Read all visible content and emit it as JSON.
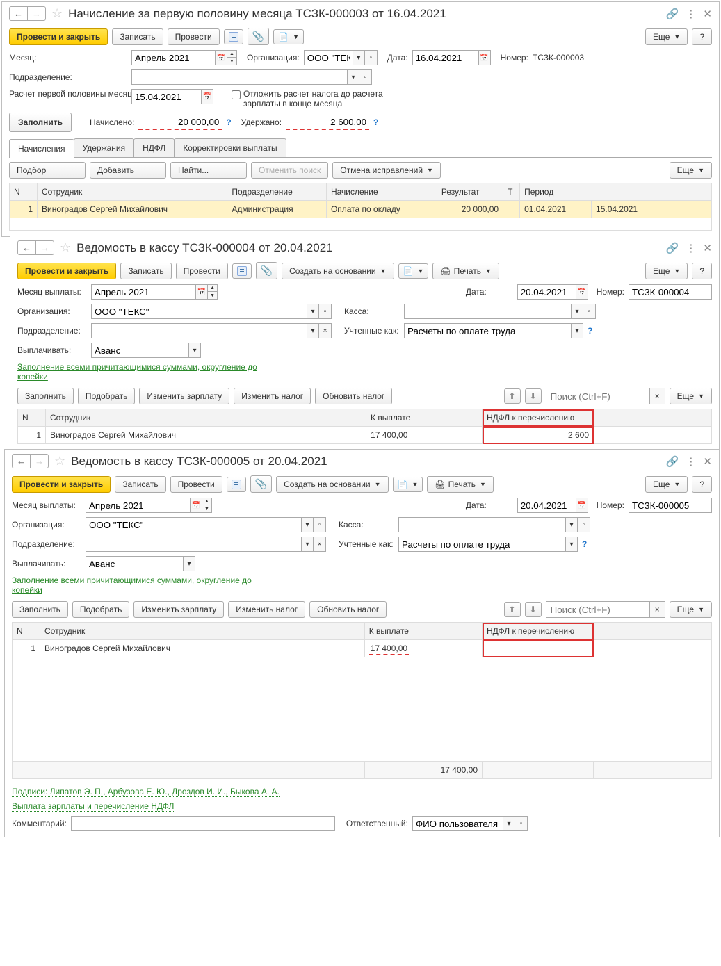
{
  "common": {
    "provesti_zakryt": "Провести и закрыть",
    "zapisat": "Записать",
    "provesti": "Провести",
    "esche": "Еще",
    "help": "?",
    "sozdat_na_osnovanii": "Создать на основании",
    "pechat": "Печать",
    "zapolnit": "Заполнить",
    "podobrat": "Подобрать",
    "izmenit_zarplatu": "Изменить зарплату",
    "izmenit_nalog": "Изменить налог",
    "obnovit_nalog": "Обновить налог",
    "poisk_placeholder": "Поиск (Ctrl+F)",
    "dobavit": "Добавить",
    "naiti": "Найти...",
    "otmenit_poisk": "Отменить поиск",
    "otmena_ispravleni": "Отмена исправлений",
    "podbor": "Подбор",
    "data_lbl": "Дата:",
    "nomer_lbl": "Номер:",
    "organizaciya_lbl": "Организация:",
    "podrazdelenie_lbl": "Подразделение:",
    "kassa_lbl": "Касса:",
    "uchtennye_kak_lbl": "Учтенные как:",
    "vyplachivat_lbl": "Выплачивать:",
    "mesyac_vyplaty_lbl": "Месяц выплаты:",
    "kommentariy_lbl": "Комментарий:",
    "otvetstvennyj_lbl": "Ответственный:",
    "fio_polzovatelya": "ФИО пользователя",
    "zapolnenie_link": "Заполнение всеми причитающимися суммами, округление до копейки",
    "podpisi_link": "Подписи: Липатов Э. П., Арбузова Е. Ю., Дроздов И. И., Быкова А. А.",
    "vyplata_link": "Выплата зарплаты и перечисление НДФЛ",
    "col_n": "N",
    "col_sotrudnik": "Сотрудник",
    "col_k_vyplate": "К выплате",
    "col_ndfl_perech": "НДФЛ к перечислению",
    "raschety_oplate_truda": "Расчеты по оплате труда",
    "avans": "Аванс",
    "month": "Апрель 2021",
    "org_teks": "ООО \"ТЕКС\""
  },
  "w1": {
    "title": "Начисление за первую половину месяца ТСЗК-000003 от 16.04.2021",
    "mesyac_lbl": "Месяц:",
    "org_short": "ООО \"ТЕК",
    "date": "16.04.2021",
    "nomer": "ТСЗК-000003",
    "raschet_lbl": "Расчет первой половины месяца до:",
    "raschet_date": "15.04.2021",
    "otlozhit": "Отложить расчет налога до расчета зарплаты в конце месяца",
    "zapolnit": "Заполнить",
    "nachisleno_lbl": "Начислено:",
    "nachisleno": "20 000,00",
    "uderzhano_lbl": "Удержано:",
    "uderzhano": "2 600,00",
    "tabs": {
      "t1": "Начисления",
      "t2": "Удержания",
      "t3": "НДФЛ",
      "t4": "Корректировки выплаты"
    },
    "cols": {
      "podrazdelenie": "Подразделение",
      "nachislenie": "Начисление",
      "rezultat": "Результат",
      "t": "Т",
      "period": "Период"
    },
    "row": {
      "n": "1",
      "sotrudnik": "Виноградов Сергей Михайлович",
      "podrazdelenie": "Администрация",
      "nachislenie": "Оплата по окладу",
      "rezultat": "20 000,00",
      "period1": "01.04.2021",
      "period2": "15.04.2021"
    }
  },
  "w2": {
    "title": "Ведомость в кассу ТСЗК-000004 от 20.04.2021",
    "date": "20.04.2021",
    "nomer": "ТСЗК-000004",
    "row": {
      "n": "1",
      "sotrudnik": "Виноградов Сергей Михайлович",
      "k_vyplate": "17 400,00",
      "ndfl": "2 600"
    }
  },
  "w3": {
    "title": "Ведомость в кассу ТСЗК-000005 от 20.04.2021",
    "date": "20.04.2021",
    "nomer": "ТСЗК-000005",
    "row": {
      "n": "1",
      "sotrudnik": "Виноградов Сергей Михайлович",
      "k_vyplate": "17 400,00",
      "ndfl": ""
    },
    "total": "17 400,00"
  }
}
